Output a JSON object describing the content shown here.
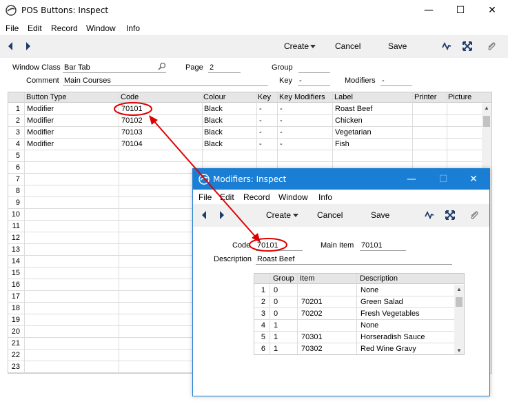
{
  "colors": {
    "accent": "#1a7fd4",
    "annotation_red": "#e00000",
    "toolbar_bg": "#f0f0f0"
  },
  "main_window": {
    "title": "POS Buttons: Inspect",
    "menu": [
      "File",
      "Edit",
      "Record",
      "Window",
      "Info"
    ],
    "toolbar": {
      "create_label": "Create",
      "cancel_label": "Cancel",
      "save_label": "Save"
    },
    "header": {
      "window_class_label": "Window Class",
      "window_class_value": "Bar Tab",
      "page_label": "Page",
      "page_value": "2",
      "group_label": "Group",
      "group_value": "",
      "comment_label": "Comment",
      "comment_value": "Main Courses",
      "key_label": "Key",
      "key_value": "-",
      "modifiers_label": "Modifiers",
      "modifiers_value": "-"
    },
    "grid": {
      "columns": [
        "Button Type",
        "Code",
        "Colour",
        "Key",
        "Key Modifiers",
        "Label",
        "Printer",
        "Picture"
      ],
      "rows": [
        {
          "num": "1",
          "type": "Modifier",
          "code": "70101",
          "colour": "Black",
          "key": "-",
          "keymod": "-",
          "label": "Roast Beef"
        },
        {
          "num": "2",
          "type": "Modifier",
          "code": "70102",
          "colour": "Black",
          "key": "-",
          "keymod": "-",
          "label": "Chicken"
        },
        {
          "num": "3",
          "type": "Modifier",
          "code": "70103",
          "colour": "Black",
          "key": "-",
          "keymod": "-",
          "label": "Vegetarian"
        },
        {
          "num": "4",
          "type": "Modifier",
          "code": "70104",
          "colour": "Black",
          "key": "-",
          "keymod": "-",
          "label": "Fish"
        },
        {
          "num": "5"
        },
        {
          "num": "6"
        },
        {
          "num": "7"
        },
        {
          "num": "8"
        },
        {
          "num": "9"
        },
        {
          "num": "10"
        },
        {
          "num": "11"
        },
        {
          "num": "12"
        },
        {
          "num": "13"
        },
        {
          "num": "14"
        },
        {
          "num": "15"
        },
        {
          "num": "16"
        },
        {
          "num": "17"
        },
        {
          "num": "18"
        },
        {
          "num": "19"
        },
        {
          "num": "20"
        },
        {
          "num": "21"
        },
        {
          "num": "22"
        },
        {
          "num": "23"
        }
      ]
    }
  },
  "modifiers_window": {
    "title": "Modifiers: Inspect",
    "menu": [
      "File",
      "Edit",
      "Record",
      "Window",
      "Info"
    ],
    "toolbar": {
      "create_label": "Create",
      "cancel_label": "Cancel",
      "save_label": "Save"
    },
    "header": {
      "code_label": "Code",
      "code_value": "70101",
      "main_item_label": "Main Item",
      "main_item_value": "70101",
      "description_label": "Description",
      "description_value": "Roast Beef"
    },
    "grid": {
      "columns": [
        "Group",
        "Item",
        "Description"
      ],
      "rows": [
        {
          "num": "1",
          "group": "0",
          "item": "",
          "desc": "None"
        },
        {
          "num": "2",
          "group": "0",
          "item": "70201",
          "desc": "Green Salad"
        },
        {
          "num": "3",
          "group": "0",
          "item": "70202",
          "desc": "Fresh Vegetables"
        },
        {
          "num": "4",
          "group": "1",
          "item": "",
          "desc": "None"
        },
        {
          "num": "5",
          "group": "1",
          "item": "70301",
          "desc": "Horseradish Sauce"
        },
        {
          "num": "6",
          "group": "1",
          "item": "70302",
          "desc": "Red Wine Gravy"
        }
      ]
    }
  }
}
